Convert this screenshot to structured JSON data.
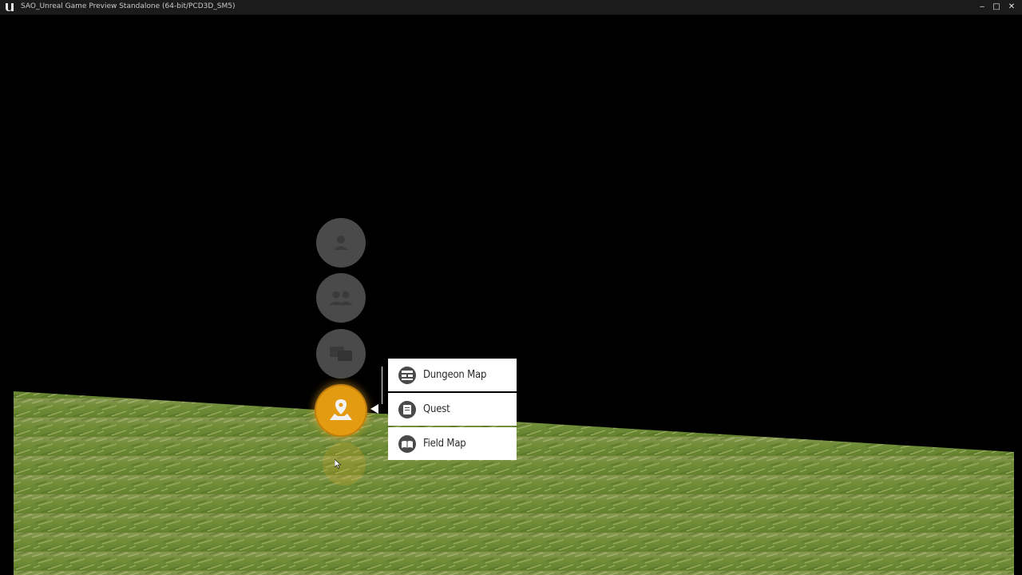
{
  "window": {
    "title": "SAO_Unreal Game Preview Standalone (64-bit/PCD3D_SM5)",
    "minimize_glyph": "‒",
    "maximize_glyph": "□",
    "close_glyph": "✕"
  },
  "ring_menu": {
    "items": [
      {
        "icon": "user-icon",
        "active": false
      },
      {
        "icon": "party-icon",
        "active": false
      },
      {
        "icon": "chat-icon",
        "active": false
      },
      {
        "icon": "map-pin-icon",
        "active": true
      }
    ],
    "active_color": "#e39b12",
    "inactive_color": "#4a4a4a"
  },
  "submenu": {
    "items": [
      {
        "label": "Dungeon Map",
        "icon": "dungeon-map-icon"
      },
      {
        "label": "Quest",
        "icon": "quest-icon"
      },
      {
        "label": "Field Map",
        "icon": "field-map-icon"
      }
    ]
  }
}
